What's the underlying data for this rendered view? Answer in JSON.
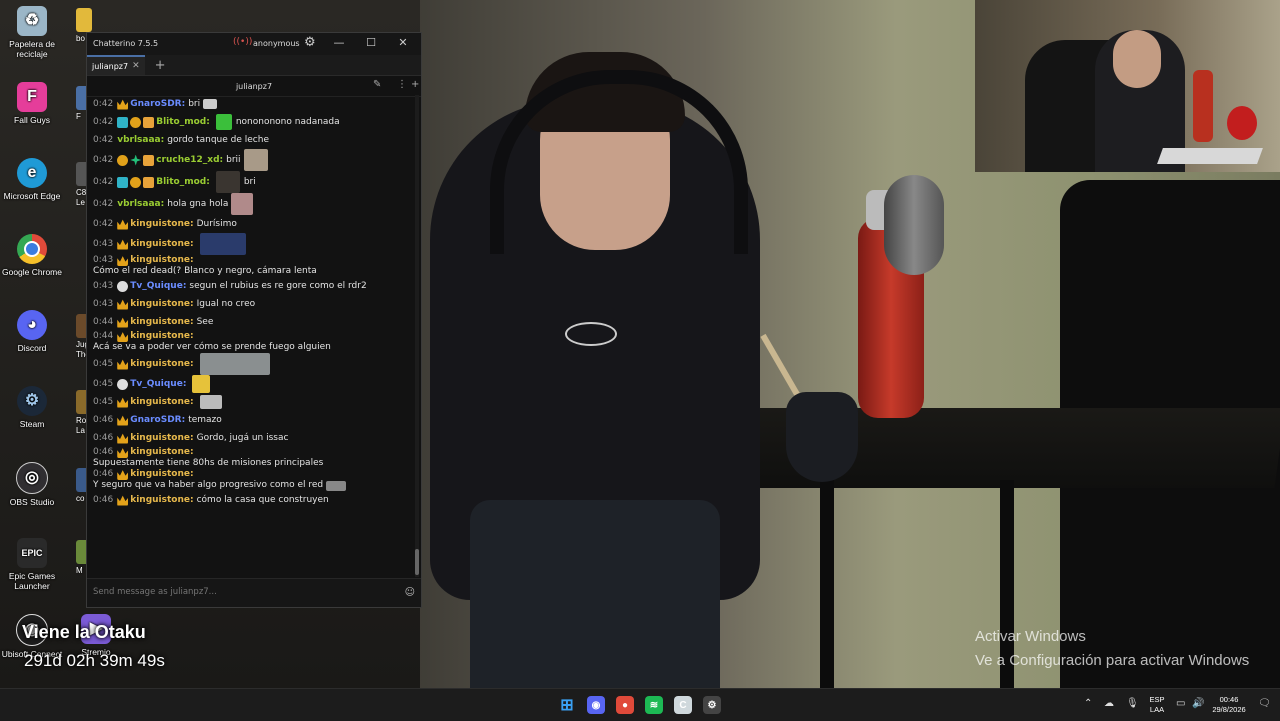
{
  "desktop": {
    "icons": [
      {
        "label": "Papelera de reciclaje",
        "icon": "recycle-bin-icon",
        "color": "#9bb6c7"
      },
      {
        "label": "Fall Guys",
        "icon": "fall-guys-icon",
        "color": "#e53d9a"
      },
      {
        "label": "Microsoft Edge",
        "icon": "edge-icon",
        "color": "#1f9ad6"
      },
      {
        "label": "Google Chrome",
        "icon": "chrome-icon",
        "color": "#e04a3a"
      },
      {
        "label": "Discord",
        "icon": "discord-icon",
        "color": "#5865f2"
      },
      {
        "label": "Steam",
        "icon": "steam-icon",
        "color": "#1b2838"
      },
      {
        "label": "OBS Studio",
        "icon": "obs-icon",
        "color": "#302e31"
      },
      {
        "label": "Epic Games Launcher",
        "icon": "epic-games-icon",
        "color": "#2a2a2a"
      },
      {
        "label": "Ubisoft Connect",
        "icon": "ubisoft-icon",
        "color": "#1d1d1d"
      }
    ],
    "partial_icons": [
      "bo",
      "F",
      "C8 Le",
      "Jug The",
      "Rock La",
      "co",
      "M"
    ],
    "stremio_label": "Stremio"
  },
  "chatterino": {
    "title": "Chatterino 7.5.5",
    "account": "anonymous",
    "tab_label": "julianpz7",
    "channel": "julianpz7",
    "input_placeholder": "Send message as julianpz7...",
    "messages": [
      {
        "time": "0:42",
        "badges": [
          "crown"
        ],
        "user": "GnaroSDR:",
        "color": "#6a8cff",
        "text": "bri",
        "emote": {
          "w": 14,
          "h": 10,
          "color": "#ccc"
        }
      },
      {
        "time": "0:42",
        "badges": [
          "b-sub",
          "b-bits",
          "b-vip"
        ],
        "user": "Blito_mod:",
        "color": "#9acd32",
        "text": "",
        "emote": {
          "w": 16,
          "h": 16,
          "color": "#3bbf3b"
        },
        "after": "nonononono nadanada"
      },
      {
        "time": "0:42",
        "badges": [],
        "user": "vbrlsaaa:",
        "color": "#9acd32",
        "text": "gordo tanque de leche"
      },
      {
        "time": "0:42",
        "badges": [
          "b-bits",
          "b-star",
          "b-vip"
        ],
        "user": "cruche12_xd:",
        "color": "#9acd32",
        "text": "brii",
        "emote": {
          "w": 24,
          "h": 22,
          "color": "#a89a88"
        }
      },
      {
        "time": "0:42",
        "badges": [
          "b-sub",
          "b-bits",
          "b-vip"
        ],
        "user": "Blito_mod:",
        "color": "#9acd32",
        "text": "",
        "emote": {
          "w": 24,
          "h": 22,
          "color": "#3a3530"
        },
        "after": "bri"
      },
      {
        "time": "0:42",
        "badges": [],
        "user": "vbrlsaaa:",
        "color": "#9acd32",
        "text": "hola gna hola",
        "emote": {
          "w": 22,
          "h": 22,
          "color": "#b08a8a"
        }
      },
      {
        "time": "0:42",
        "badges": [
          "crown"
        ],
        "user": "kinguistone:",
        "color": "#e6b84c",
        "text": "Durísimo"
      },
      {
        "time": "0:43",
        "badges": [
          "crown"
        ],
        "user": "kinguistone:",
        "color": "#e6b84c",
        "text": "",
        "emote": {
          "w": 46,
          "h": 22,
          "color": "#2a3b6b"
        }
      },
      {
        "time": "0:43",
        "badges": [
          "crown"
        ],
        "user": "kinguistone:",
        "color": "#e6b84c",
        "text": "Cómo el red dead(? Blanco y negro, cámara lenta"
      },
      {
        "time": "0:43",
        "badges": [
          "b-face"
        ],
        "user": "Tv_Quique:",
        "color": "#6a8cff",
        "text": "segun el rubius es re gore como el rdr2"
      },
      {
        "time": "0:43",
        "badges": [
          "crown"
        ],
        "user": "kinguistone:",
        "color": "#e6b84c",
        "text": "Igual no creo"
      },
      {
        "time": "0:44",
        "badges": [
          "crown"
        ],
        "user": "kinguistone:",
        "color": "#e6b84c",
        "text": "See"
      },
      {
        "time": "0:44",
        "badges": [
          "crown"
        ],
        "user": "kinguistone:",
        "color": "#e6b84c",
        "text": "Acá se va a poder ver cómo se prende fuego alguien"
      },
      {
        "time": "0:45",
        "badges": [
          "crown"
        ],
        "user": "kinguistone:",
        "color": "#e6b84c",
        "text": "",
        "emote": {
          "w": 70,
          "h": 22,
          "color": "#8a8f90"
        }
      },
      {
        "time": "0:45",
        "badges": [
          "b-face"
        ],
        "user": "Tv_Quique:",
        "color": "#6a8cff",
        "text": "",
        "emote": {
          "w": 18,
          "h": 18,
          "color": "#e6c23a"
        }
      },
      {
        "time": "0:45",
        "badges": [
          "crown"
        ],
        "user": "kinguistone:",
        "color": "#e6b84c",
        "text": "",
        "emote": {
          "w": 22,
          "h": 14,
          "color": "#bbb"
        }
      },
      {
        "time": "0:46",
        "badges": [
          "crown"
        ],
        "user": "GnaroSDR:",
        "color": "#6a8cff",
        "text": "temazo"
      },
      {
        "time": "0:46",
        "badges": [
          "crown"
        ],
        "user": "kinguistone:",
        "color": "#e6b84c",
        "text": "Gordo, jugá un issac"
      },
      {
        "time": "0:46",
        "badges": [
          "crown"
        ],
        "user": "kinguistone:",
        "color": "#e6b84c",
        "text": "Supuestamente tiene 80hs de misiones principales"
      },
      {
        "time": "0:46",
        "badges": [
          "crown"
        ],
        "user": "kinguistone:",
        "color": "#e6b84c",
        "text": "Y seguro que va haber algo progresivo como el red",
        "emote": {
          "w": 20,
          "h": 10,
          "color": "#888"
        }
      },
      {
        "time": "0:46",
        "badges": [
          "crown"
        ],
        "user": "kinguistone:",
        "color": "#e6b84c",
        "text": "cómo la casa que construyen"
      }
    ]
  },
  "stream_overlay": {
    "title": "Viene la Otaku",
    "timer": "291d 02h 39m 49s"
  },
  "watermark": {
    "line1": "Activar Windows",
    "line2": "Ve a Configuración para activar Windows"
  },
  "taskbar": {
    "apps": [
      {
        "name": "windows-start-icon",
        "color": "#3aa0f3",
        "glyph": "⊞"
      },
      {
        "name": "discord-taskbar-icon",
        "color": "#5865f2",
        "glyph": "◉"
      },
      {
        "name": "chrome-taskbar-icon",
        "color": "#e04a3a",
        "glyph": "●"
      },
      {
        "name": "spotify-taskbar-icon",
        "color": "#1db954",
        "glyph": "≋"
      },
      {
        "name": "ccleaner-taskbar-icon",
        "color": "#cfd8dc",
        "glyph": "C"
      },
      {
        "name": "chatterino-taskbar-icon",
        "color": "#444",
        "glyph": "⚙"
      }
    ],
    "lang_top": "ESP",
    "lang_bottom": "LAA",
    "time": "00:46",
    "date": "29/8/2026"
  }
}
